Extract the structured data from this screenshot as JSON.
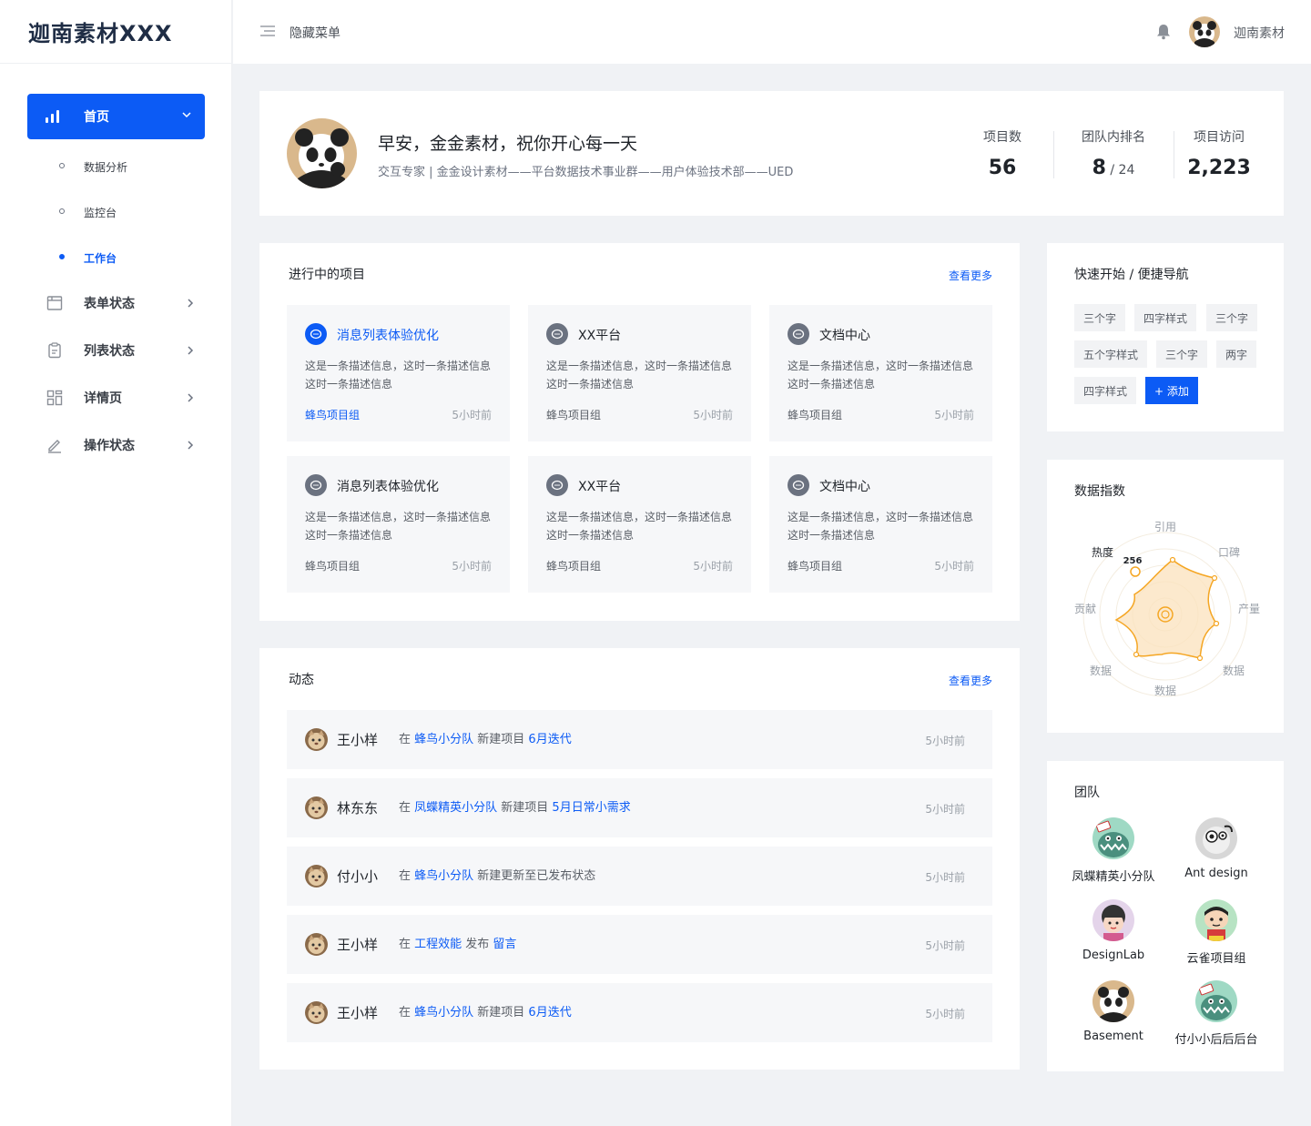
{
  "app": {
    "logo": "迦南素材XXX"
  },
  "sidebar": {
    "home": {
      "label": "首页",
      "icon": "bar-chart-icon"
    },
    "home_sub": [
      {
        "label": "数据分析",
        "active": false
      },
      {
        "label": "监控台",
        "active": false
      },
      {
        "label": "工作台",
        "active": true
      }
    ],
    "items": [
      {
        "label": "表单状态",
        "icon": "form-icon"
      },
      {
        "label": "列表状态",
        "icon": "clipboard-icon"
      },
      {
        "label": "详情页",
        "icon": "grid-icon"
      },
      {
        "label": "操作状态",
        "icon": "pen-icon"
      }
    ]
  },
  "topbar": {
    "menu_toggle": "隐藏菜单",
    "username": "迦南素材",
    "icons": [
      "menu-icon",
      "bell-icon"
    ]
  },
  "welcome": {
    "greeting": "早安，金金素材，祝你开心每一天",
    "subtitle": "交互专家 | 金金设计素材——平台数据技术事业群——用户体验技术部——UED",
    "stats": [
      {
        "label": "项目数",
        "value": "56",
        "suffix": ""
      },
      {
        "label": "团队内排名",
        "value": "8",
        "suffix": " / 24"
      },
      {
        "label": "项目访问",
        "value": "2,223",
        "suffix": ""
      }
    ]
  },
  "projects": {
    "title": "进行中的项目",
    "more": "查看更多",
    "items": [
      {
        "title": "消息列表体验优化",
        "desc": "这是一条描述信息，这时一条描述信息这时一条描述信息",
        "group": "蜂鸟项目组",
        "time": "5小时前",
        "highlight": true
      },
      {
        "title": "XX平台",
        "desc": "这是一条描述信息，这时一条描述信息这时一条描述信息",
        "group": "蜂鸟项目组",
        "time": "5小时前",
        "highlight": false
      },
      {
        "title": "文档中心",
        "desc": "这是一条描述信息，这时一条描述信息这时一条描述信息",
        "group": "蜂鸟项目组",
        "time": "5小时前",
        "highlight": false
      },
      {
        "title": "消息列表体验优化",
        "desc": "这是一条描述信息，这时一条描述信息这时一条描述信息",
        "group": "蜂鸟项目组",
        "time": "5小时前",
        "highlight": false
      },
      {
        "title": "XX平台",
        "desc": "这是一条描述信息，这时一条描述信息这时一条描述信息",
        "group": "蜂鸟项目组",
        "time": "5小时前",
        "highlight": false
      },
      {
        "title": "文档中心",
        "desc": "这是一条描述信息，这时一条描述信息这时一条描述信息",
        "group": "蜂鸟项目组",
        "time": "5小时前",
        "highlight": false
      }
    ]
  },
  "activity": {
    "title": "动态",
    "more": "查看更多",
    "items": [
      {
        "name": "王小样",
        "parts": [
          [
            "在 ",
            false
          ],
          [
            "蜂鸟小分队",
            true
          ],
          [
            " 新建项目 ",
            false
          ],
          [
            "6月迭代",
            true
          ]
        ],
        "time": "5小时前"
      },
      {
        "name": "林东东",
        "parts": [
          [
            "在 ",
            false
          ],
          [
            "凤蝶精英小分队",
            true
          ],
          [
            " 新建项目 ",
            false
          ],
          [
            "5月日常小需求",
            true
          ]
        ],
        "time": "5小时前"
      },
      {
        "name": "付小小",
        "parts": [
          [
            "在 ",
            false
          ],
          [
            "蜂鸟小分队",
            true
          ],
          [
            " 新建更新至已发布状态",
            false
          ]
        ],
        "time": "5小时前"
      },
      {
        "name": "王小样",
        "parts": [
          [
            "在 ",
            false
          ],
          [
            "工程效能",
            true
          ],
          [
            " 发布 ",
            false
          ],
          [
            "留言",
            true
          ]
        ],
        "time": "5小时前"
      },
      {
        "name": "王小样",
        "parts": [
          [
            "在 ",
            false
          ],
          [
            "蜂鸟小分队",
            true
          ],
          [
            " 新建项目 ",
            false
          ],
          [
            "6月迭代",
            true
          ]
        ],
        "time": "5小时前"
      }
    ]
  },
  "quick": {
    "title": "快速开始 / 便捷导航",
    "tags": [
      "三个字",
      "四字样式",
      "三个字",
      "五个字样式",
      "三个字",
      "两字",
      "四字样式"
    ],
    "add_label": "+ 添加"
  },
  "data_index": {
    "title": "数据指数",
    "axes": [
      "引用",
      "口碑",
      "产量",
      "数据",
      "数据",
      "数据",
      "贡献",
      "热度"
    ],
    "highlight": {
      "axis": "热度",
      "value": "256"
    }
  },
  "team": {
    "title": "团队",
    "members": [
      {
        "name": "凤蝶精英小分队",
        "avatar": "monster-avatar"
      },
      {
        "name": "Ant design",
        "avatar": "eye-avatar"
      },
      {
        "name": "DesignLab",
        "avatar": "girl-avatar"
      },
      {
        "name": "云雀项目组",
        "avatar": "boy-avatar"
      },
      {
        "name": "Basement",
        "avatar": "panda-avatar"
      },
      {
        "name": "付小小后后后台",
        "avatar": "monster-avatar"
      }
    ]
  },
  "colors": {
    "accent": "#0c5bf5",
    "background": "#f0f2f5",
    "radar": "#f5a623"
  }
}
